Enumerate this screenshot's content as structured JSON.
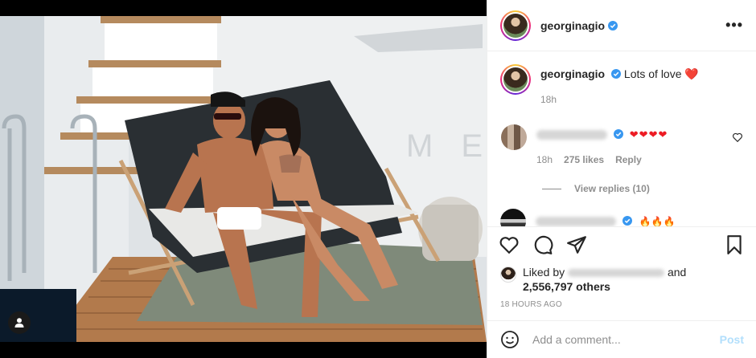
{
  "post": {
    "username": "georginagio",
    "caption": "Lots of love",
    "caption_emoji": "❤️",
    "caption_age": "18h",
    "more_label": "•••"
  },
  "comments": [
    {
      "hearts": "❤❤❤❤",
      "age": "18h",
      "likes": "275 likes",
      "reply_label": "Reply",
      "view_replies": "View replies (10)"
    },
    {
      "emojis": "🔥🔥🔥"
    }
  ],
  "likes": {
    "prefix": "Liked by",
    "suffix": "and",
    "others": "2,556,797 others"
  },
  "timestamp": "18 HOURS AGO",
  "composer": {
    "placeholder": "Add a comment...",
    "post_label": "Post"
  },
  "colors": {
    "verified": "#3897f0",
    "heart": "#ed4956",
    "post_disabled": "#b2dffc"
  },
  "icons": [
    "verified-icon",
    "heart-icon",
    "comment-icon",
    "share-icon",
    "save-icon",
    "smiley-icon",
    "user-tag-icon",
    "more-icon"
  ]
}
